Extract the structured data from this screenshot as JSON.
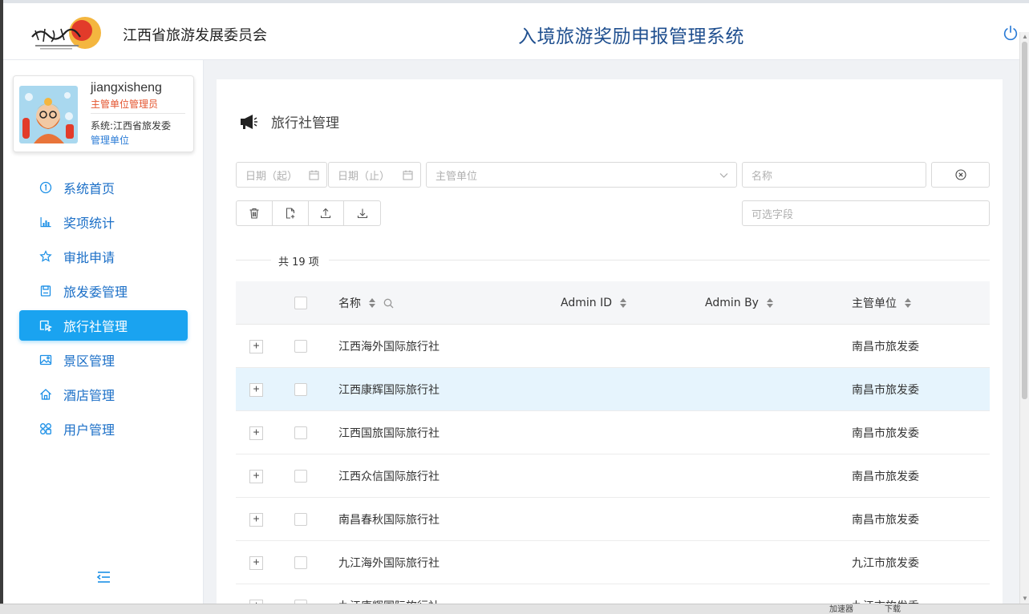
{
  "header": {
    "org_title": "江西省旅游发展委员会",
    "system_title": "入境旅游奖励申报管理系统"
  },
  "profile": {
    "username": "jiangxisheng",
    "role": "主管单位管理员",
    "system": "系统:江西省旅发委",
    "unit": "管理单位"
  },
  "sidebar": {
    "items": [
      {
        "label": "系统首页",
        "icon": "info-circle-icon"
      },
      {
        "label": "奖项统计",
        "icon": "bar-chart-icon"
      },
      {
        "label": "审批申请",
        "icon": "star-icon"
      },
      {
        "label": "旅发委管理",
        "icon": "save-icon"
      },
      {
        "label": "旅行社管理",
        "icon": "cursor-icon",
        "active": true
      },
      {
        "label": "景区管理",
        "icon": "picture-icon"
      },
      {
        "label": "酒店管理",
        "icon": "home-icon"
      },
      {
        "label": "用户管理",
        "icon": "apps-icon"
      }
    ]
  },
  "page": {
    "title": "旅行社管理",
    "filters": {
      "date_from": "日期（起）",
      "date_to": "日期（止）",
      "unit_select": "主管单位",
      "name_input": "名称",
      "optional_fields": "可选字段"
    },
    "count_text": "共 19 项"
  },
  "table": {
    "columns": [
      "名称",
      "Admin ID",
      "Admin By",
      "主管单位"
    ],
    "rows": [
      {
        "name": "江西海外国际旅行社",
        "admin_id": "",
        "admin_by": "",
        "unit": "南昌市旅发委"
      },
      {
        "name": "江西康辉国际旅行社",
        "admin_id": "",
        "admin_by": "",
        "unit": "南昌市旅发委",
        "highlighted": true
      },
      {
        "name": "江西国旅国际旅行社",
        "admin_id": "",
        "admin_by": "",
        "unit": "南昌市旅发委"
      },
      {
        "name": "江西众信国际旅行社",
        "admin_id": "",
        "admin_by": "",
        "unit": "南昌市旅发委"
      },
      {
        "name": "南昌春秋国际旅行社",
        "admin_id": "",
        "admin_by": "",
        "unit": "南昌市旅发委"
      },
      {
        "name": "九江海外国际旅行社",
        "admin_id": "",
        "admin_by": "",
        "unit": "九江市旅发委"
      },
      {
        "name": "九江康辉国际旅行社",
        "admin_id": "",
        "admin_by": "",
        "unit": "九江市旅发委"
      }
    ]
  },
  "statusbar": {
    "accelerator": "加速器",
    "download": "下载"
  },
  "colors": {
    "accent": "#1aa3f0",
    "title_blue": "#1f4f8f",
    "role_red": "#e4542e",
    "row_highlight": "#e6f4fd"
  }
}
